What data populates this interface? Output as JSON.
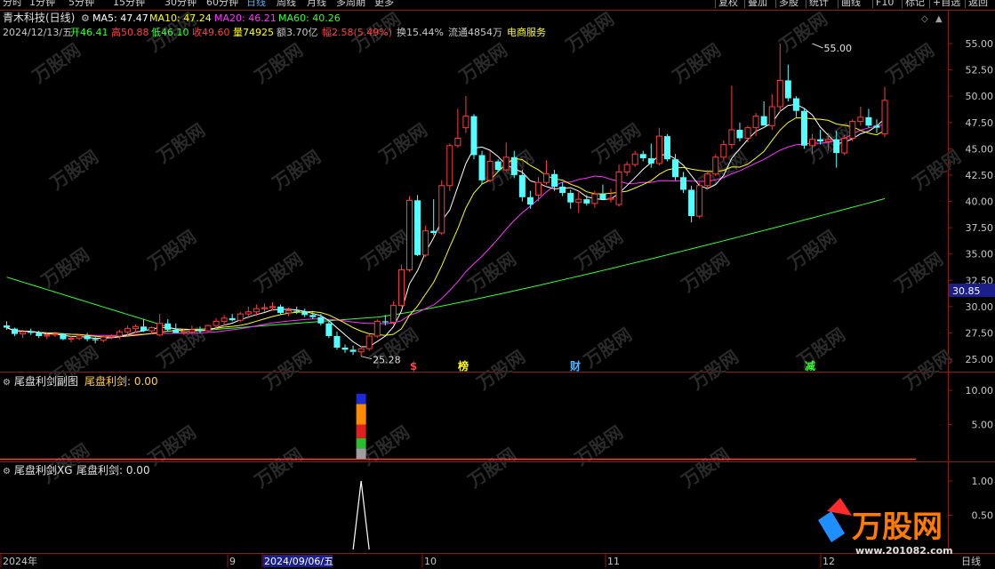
{
  "toolbar": {
    "left": [
      "分时",
      "1分钟",
      "5分钟",
      "15分钟",
      "30分钟",
      "60分钟",
      "日线",
      "周线",
      "月线",
      "多周期",
      "更多"
    ],
    "active": "日线",
    "right": [
      "复权",
      "叠加",
      "多股",
      "统计",
      "画线",
      "F10",
      "标记",
      "+自选",
      "返回"
    ]
  },
  "header": {
    "stock_title": "青木科技(日线)",
    "ma": [
      {
        "label": "MA5: 47.47",
        "color": "#ffffff"
      },
      {
        "label": "MA10: 47.24",
        "color": "#ffff00"
      },
      {
        "label": "MA20: 46.21",
        "color": "#ff33ff"
      },
      {
        "label": "MA60: 40.26",
        "color": "#33ff33"
      }
    ],
    "info": [
      {
        "text": "2024/12/13/五",
        "color": "#c8c8c8"
      },
      {
        "text": "开46.41",
        "color": "#33ff33"
      },
      {
        "text": "高50.88",
        "color": "#ff4040"
      },
      {
        "text": "低46.10",
        "color": "#33ff33"
      },
      {
        "text": "收49.60",
        "color": "#ff4040"
      },
      {
        "text": "量74925",
        "color": "#ffff00"
      },
      {
        "text": "额3.70亿",
        "color": "#c8c8c8"
      },
      {
        "text": "幅2.58(5.49%)",
        "color": "#ff4040"
      },
      {
        "text": "换15.44%",
        "color": "#c8c8c8"
      },
      {
        "text": "流通4854万",
        "color": "#c8c8c8"
      },
      {
        "text": "电商服务",
        "color": "#ffff00"
      }
    ]
  },
  "price_axis": {
    "ticks": [
      "55.00",
      "52.50",
      "50.00",
      "47.50",
      "45.00",
      "42.50",
      "40.00",
      "37.50",
      "35.00",
      "32.50",
      "30.00",
      "27.50",
      "25.00"
    ],
    "current": "30.85"
  },
  "annotations": {
    "high_label": "55.00",
    "low_label": "25.28",
    "markers": [
      {
        "text": "$",
        "color": "#ff4040"
      },
      {
        "text": "榜",
        "color": "#ffff00"
      },
      {
        "text": "财",
        "color": "#4fb3ff"
      },
      {
        "text": "减",
        "color": "#33ff33"
      }
    ]
  },
  "panel2": {
    "name": "尾盘利剑副图",
    "indicator": "尾盘利剑: 0.00",
    "ticks": [
      "10.00",
      "5.00"
    ]
  },
  "panel3": {
    "name": "尾盘利剑XG",
    "indicator": "尾盘利剑: 0.00",
    "ticks": [
      "1.00",
      "0.50"
    ]
  },
  "date_axis": {
    "labels": [
      "2024年",
      "9",
      "2024/09/06/五",
      "10",
      "11",
      "12"
    ],
    "period_label": "日线"
  },
  "watermark": {
    "text": "万股网",
    "url": "www.201082.com"
  },
  "chart_data": {
    "type": "candlestick",
    "ylim": [
      24,
      56.5
    ],
    "candles": [
      [
        28.2,
        28.6,
        27.8,
        28.0
      ],
      [
        27.9,
        28.0,
        27.2,
        27.4
      ],
      [
        27.4,
        27.8,
        27.0,
        27.6
      ],
      [
        27.6,
        27.9,
        27.3,
        27.5
      ],
      [
        27.5,
        27.7,
        27.0,
        27.2
      ],
      [
        27.2,
        27.5,
        26.9,
        27.3
      ],
      [
        27.3,
        27.6,
        27.1,
        27.4
      ],
      [
        27.4,
        27.5,
        26.8,
        26.9
      ],
      [
        26.9,
        27.2,
        26.6,
        27.0
      ],
      [
        27.0,
        27.4,
        26.8,
        27.2
      ],
      [
        27.2,
        27.5,
        26.7,
        26.9
      ],
      [
        26.9,
        27.1,
        26.5,
        26.8
      ],
      [
        26.8,
        27.2,
        26.6,
        27.1
      ],
      [
        27.1,
        27.4,
        26.9,
        27.2
      ],
      [
        27.2,
        27.8,
        26.9,
        27.6
      ],
      [
        27.6,
        28.2,
        27.2,
        27.9
      ],
      [
        27.9,
        28.3,
        27.5,
        28.1
      ],
      [
        28.1,
        28.8,
        27.6,
        27.7
      ],
      [
        27.7,
        28.1,
        27.4,
        28.0
      ],
      [
        27.3,
        29.3,
        27.2,
        28.4
      ],
      [
        28.4,
        28.8,
        27.6,
        27.8
      ],
      [
        27.8,
        28.4,
        27.6,
        27.5
      ],
      [
        27.5,
        27.9,
        27.3,
        27.6
      ],
      [
        27.6,
        28.2,
        27.4,
        27.8
      ],
      [
        27.8,
        28.1,
        27.5,
        27.7
      ],
      [
        27.7,
        28.3,
        27.6,
        28.2
      ],
      [
        28.2,
        28.9,
        27.9,
        28.6
      ],
      [
        28.6,
        29.2,
        28.2,
        28.9
      ],
      [
        28.9,
        29.3,
        28.6,
        28.7
      ],
      [
        28.7,
        29.5,
        28.5,
        29.3
      ],
      [
        29.3,
        30.0,
        28.9,
        29.5
      ],
      [
        29.5,
        30.2,
        29.1,
        29.8
      ],
      [
        29.8,
        30.3,
        29.5,
        29.9
      ],
      [
        29.9,
        30.4,
        29.6,
        30.0
      ],
      [
        30.0,
        30.2,
        29.2,
        29.4
      ],
      [
        29.4,
        29.9,
        29.1,
        29.6
      ],
      [
        29.6,
        30.0,
        29.3,
        29.5
      ],
      [
        29.5,
        29.8,
        29.0,
        29.2
      ],
      [
        29.2,
        29.6,
        28.8,
        29.0
      ],
      [
        29.0,
        29.3,
        28.2,
        28.4
      ],
      [
        28.4,
        28.7,
        27.0,
        27.2
      ],
      [
        27.2,
        27.6,
        25.9,
        26.1
      ],
      [
        26.1,
        26.4,
        25.6,
        25.9
      ],
      [
        25.9,
        26.3,
        25.4,
        25.7
      ],
      [
        25.7,
        26.2,
        25.28,
        26.0
      ],
      [
        26.0,
        27.4,
        25.8,
        27.2
      ],
      [
        27.2,
        28.8,
        27.0,
        28.6
      ],
      [
        28.6,
        29.2,
        28.2,
        28.5
      ],
      [
        28.5,
        30.5,
        28.3,
        30.1
      ],
      [
        30.1,
        34.0,
        30.0,
        33.5
      ],
      [
        33.5,
        40.5,
        33.3,
        40.1
      ],
      [
        40.1,
        40.6,
        34.8,
        34.9
      ],
      [
        34.9,
        37.7,
        34.7,
        37.2
      ],
      [
        37.2,
        40.2,
        36.8,
        37.0
      ],
      [
        37.0,
        42.0,
        36.8,
        41.5
      ],
      [
        41.5,
        45.5,
        41.0,
        45.3
      ],
      [
        45.3,
        48.8,
        45.1,
        46.0
      ],
      [
        47.0,
        50.0,
        46.5,
        48.1
      ],
      [
        48.1,
        48.3,
        44.0,
        44.4
      ],
      [
        44.4,
        44.8,
        41.6,
        42.0
      ],
      [
        42.0,
        44.8,
        41.8,
        43.8
      ],
      [
        43.8,
        44.0,
        42.8,
        43.0
      ],
      [
        43.0,
        45.6,
        42.8,
        44.2
      ],
      [
        44.2,
        44.8,
        42.2,
        42.5
      ],
      [
        42.5,
        43.0,
        40.0,
        40.4
      ],
      [
        40.4,
        41.0,
        39.3,
        39.7
      ],
      [
        40.6,
        42.3,
        40.0,
        41.8
      ],
      [
        41.8,
        43.9,
        41.6,
        42.6
      ],
      [
        42.6,
        43.0,
        41.0,
        41.4
      ],
      [
        41.4,
        41.8,
        40.5,
        40.8
      ],
      [
        40.8,
        41.1,
        39.3,
        39.9
      ],
      [
        39.9,
        41.0,
        38.9,
        40.2
      ],
      [
        40.2,
        40.6,
        39.6,
        39.8
      ],
      [
        39.8,
        41.0,
        39.4,
        40.7
      ],
      [
        40.7,
        41.6,
        40.4,
        40.2
      ],
      [
        40.2,
        41.2,
        39.9,
        40.3
      ],
      [
        39.7,
        43.5,
        39.5,
        42.8
      ],
      [
        42.8,
        43.8,
        42.4,
        43.5
      ],
      [
        43.5,
        44.8,
        43.3,
        44.5
      ],
      [
        44.5,
        44.8,
        43.8,
        44.1
      ],
      [
        44.1,
        45.5,
        43.2,
        43.6
      ],
      [
        43.6,
        47.0,
        43.4,
        46.2
      ],
      [
        46.2,
        46.4,
        43.8,
        44.0
      ],
      [
        44.0,
        44.5,
        42.0,
        42.3
      ],
      [
        42.3,
        42.8,
        40.8,
        41.1
      ],
      [
        41.1,
        41.5,
        38.0,
        38.6
      ],
      [
        38.6,
        41.8,
        38.4,
        41.5
      ],
      [
        41.5,
        43.0,
        41.2,
        42.6
      ],
      [
        42.6,
        44.5,
        42.4,
        44.2
      ],
      [
        44.2,
        45.8,
        43.9,
        45.4
      ],
      [
        45.4,
        51.0,
        45.0,
        46.8
      ],
      [
        46.8,
        47.5,
        45.7,
        46.0
      ],
      [
        46.0,
        47.2,
        45.6,
        47.0
      ],
      [
        47.0,
        48.4,
        46.2,
        48.1
      ],
      [
        48.1,
        49.5,
        47.5,
        47.2
      ],
      [
        47.2,
        50.2,
        46.8,
        49.0
      ],
      [
        49.0,
        55.0,
        48.5,
        51.5
      ],
      [
        51.5,
        53.0,
        49.5,
        49.8
      ],
      [
        49.8,
        50.0,
        48.0,
        48.6
      ],
      [
        48.6,
        48.8,
        45.0,
        45.3
      ],
      [
        45.3,
        46.4,
        44.5,
        45.9
      ],
      [
        45.9,
        46.8,
        45.4,
        45.7
      ],
      [
        45.7,
        46.5,
        44.8,
        45.9
      ],
      [
        45.9,
        46.7,
        43.2,
        44.6
      ],
      [
        44.6,
        46.3,
        44.4,
        46.0
      ],
      [
        46.0,
        47.8,
        45.7,
        47.6
      ],
      [
        47.6,
        49.0,
        47.2,
        48.0
      ],
      [
        48.0,
        48.8,
        47.0,
        47.2
      ],
      [
        47.2,
        47.8,
        46.5,
        47.0
      ],
      [
        46.41,
        50.88,
        46.1,
        49.6
      ]
    ],
    "ma": [
      {
        "name": "MA5",
        "value": 47.47,
        "color": "#ffffff"
      },
      {
        "name": "MA10",
        "value": 47.24,
        "color": "#ffff00"
      },
      {
        "name": "MA20",
        "value": 46.21,
        "color": "#ff33ff"
      },
      {
        "name": "MA60",
        "value": 40.26,
        "color": "#33ff33"
      }
    ],
    "signal": {
      "date_label": "2024/09/06/五",
      "panel2_stack": [
        {
          "value": 1.5,
          "color": "#9e9e9e"
        },
        {
          "value": 1.5,
          "color": "#2bbd2b"
        },
        {
          "value": 2.0,
          "color": "#e02020"
        },
        {
          "value": 3.0,
          "color": "#ff8c00"
        },
        {
          "value": 1.5,
          "color": "#1c2ad8"
        }
      ],
      "panel2_ylim": [
        0,
        13
      ],
      "panel3_value": 1,
      "panel3_ylim": [
        0,
        1.2
      ]
    }
  }
}
